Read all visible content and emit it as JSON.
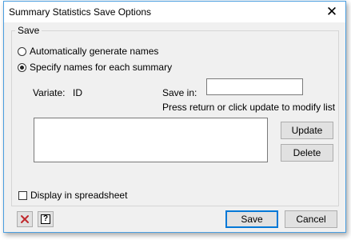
{
  "window": {
    "title": "Summary Statistics Save Options",
    "close_glyph": "✕"
  },
  "save_group": {
    "legend": "Save",
    "radio_auto": {
      "label": "Automatically generate names",
      "checked": false
    },
    "radio_specify": {
      "label": "Specify names for each summary",
      "checked": true
    },
    "variate_label": "Variate:",
    "variate_value": "ID",
    "save_in_label": "Save in:",
    "save_in_value": "",
    "hint": "Press return or click update to modify list",
    "list_items": [],
    "update_label": "Update",
    "delete_label": "Delete"
  },
  "display_in_spreadsheet": {
    "label": "Display in spreadsheet",
    "checked": false
  },
  "footer": {
    "clear_icon": "red-x-icon",
    "help_icon": "question-mark-icon",
    "help_glyph": "?",
    "save_label": "Save",
    "cancel_label": "Cancel"
  },
  "colors": {
    "accent": "#0078d7",
    "window_border": "#4a9ee0",
    "clear_icon_red": "#c0282d"
  }
}
